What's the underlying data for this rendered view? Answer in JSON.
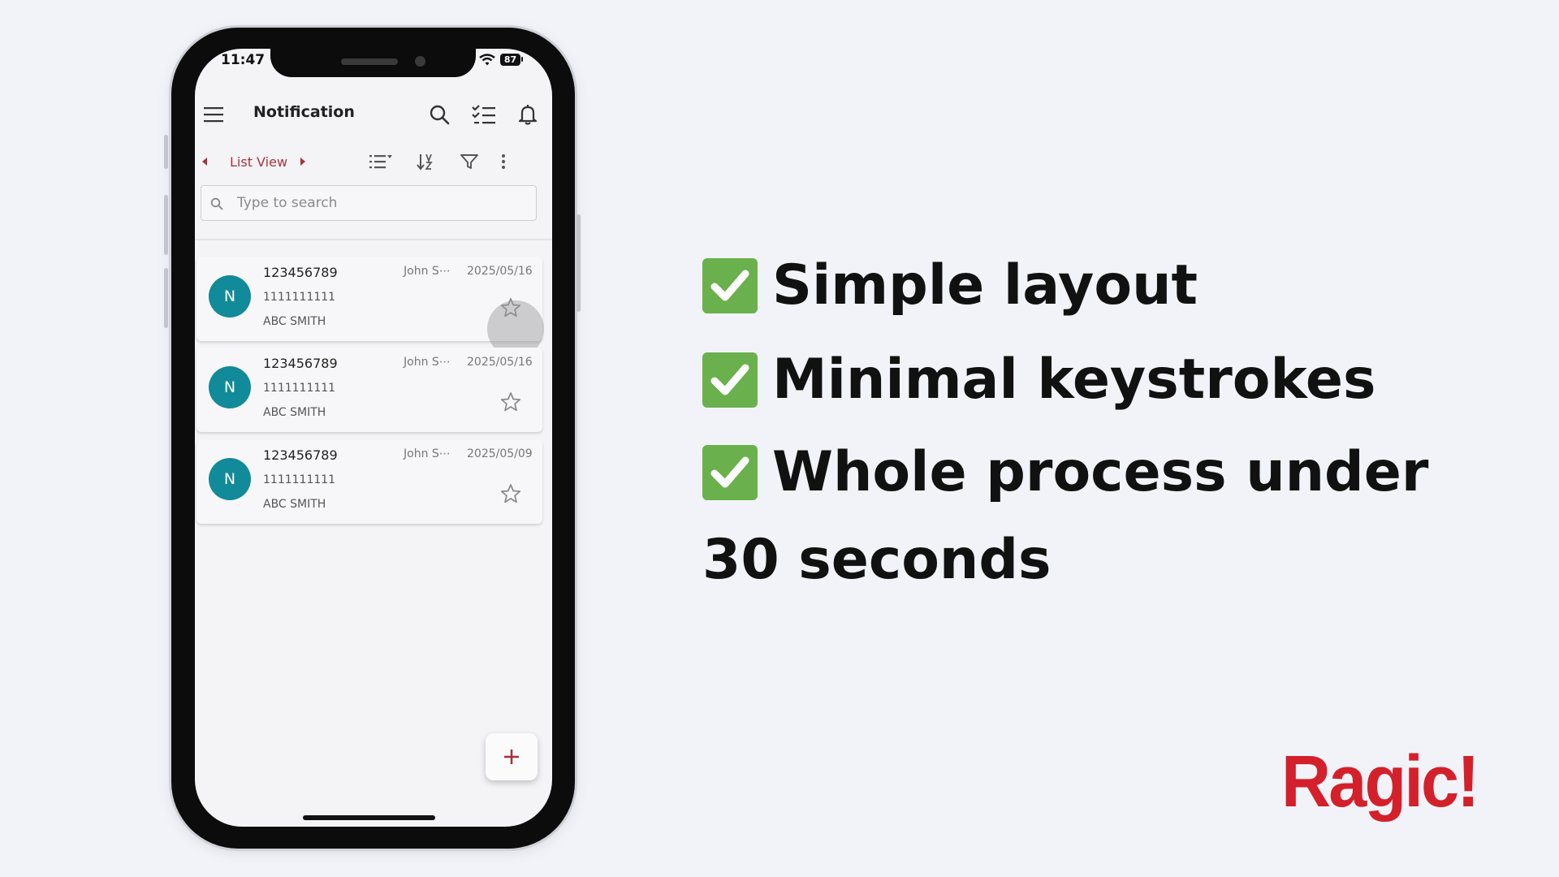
{
  "status_bar": {
    "time": "11:47",
    "battery": "87"
  },
  "header": {
    "title": "Notification"
  },
  "toolbar": {
    "view_label": "List View"
  },
  "search": {
    "placeholder": "Type to search"
  },
  "records": [
    {
      "avatar": "N",
      "title": "123456789",
      "subtitle": "1111111111",
      "name": "ABC SMITH",
      "owner": "John S⋯",
      "date": "2025/05/16"
    },
    {
      "avatar": "N",
      "title": "123456789",
      "subtitle": "1111111111",
      "name": "ABC SMITH",
      "owner": "John S⋯",
      "date": "2025/05/16"
    },
    {
      "avatar": "N",
      "title": "123456789",
      "subtitle": "1111111111",
      "name": "ABC SMITH",
      "owner": "John S⋯",
      "date": "2025/05/09"
    }
  ],
  "features": [
    {
      "text": "Simple layout"
    },
    {
      "text": "Minimal keystrokes"
    },
    {
      "text": "Whole process under"
    }
  ],
  "feature_continuation": "30 seconds",
  "brand": {
    "logo_text": "Ragic!",
    "logo_color": "#d4202a"
  },
  "colors": {
    "accent": "#a8323a",
    "avatar": "#118a99",
    "check": "#6ab04c"
  },
  "icons": [
    "menu-icon",
    "search-icon",
    "checklist-icon",
    "bell-icon",
    "list-options-icon",
    "sort-icon",
    "filter-icon",
    "more-vertical-icon",
    "star-icon",
    "plus-icon",
    "check-icon"
  ]
}
